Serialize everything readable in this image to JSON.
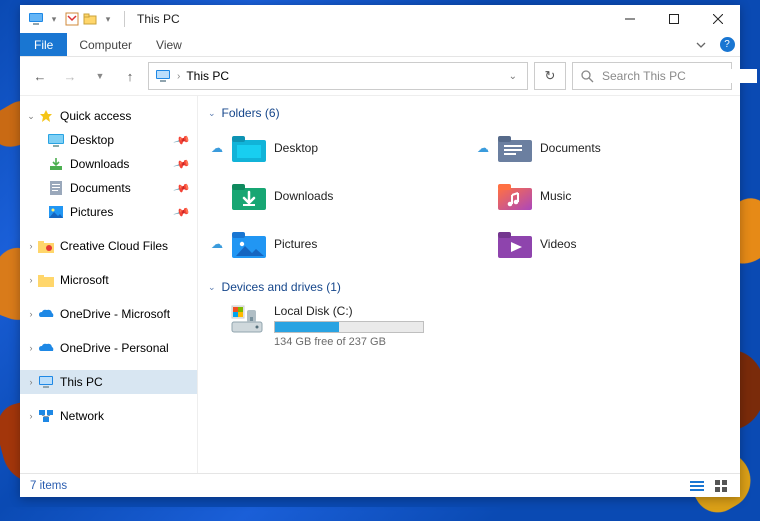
{
  "titlebar": {
    "title": "This PC"
  },
  "ribbon": {
    "file": "File",
    "tabs": [
      "Computer",
      "View"
    ]
  },
  "nav": {
    "breadcrumb_icon": "pc-icon",
    "breadcrumb": "This PC",
    "search_placeholder": "Search This PC"
  },
  "sidebar": {
    "quick_access": {
      "label": "Quick access",
      "items": [
        {
          "label": "Desktop",
          "icon": "desktop-blue",
          "pinned": true
        },
        {
          "label": "Downloads",
          "icon": "downloads",
          "pinned": true
        },
        {
          "label": "Documents",
          "icon": "documents",
          "pinned": true
        },
        {
          "label": "Pictures",
          "icon": "pictures",
          "pinned": true
        }
      ]
    },
    "roots": [
      {
        "label": "Creative Cloud Files",
        "icon": "cc-folder",
        "expandable": true
      },
      {
        "label": "Microsoft",
        "icon": "folder",
        "expandable": true
      },
      {
        "label": "OneDrive - Microsoft",
        "icon": "onedrive",
        "expandable": true
      },
      {
        "label": "OneDrive - Personal",
        "icon": "onedrive",
        "expandable": true
      },
      {
        "label": "This PC",
        "icon": "pc",
        "expandable": true,
        "selected": true
      },
      {
        "label": "Network",
        "icon": "network",
        "expandable": true
      }
    ]
  },
  "content": {
    "folders_header": "Folders (6)",
    "folders": [
      {
        "label": "Desktop",
        "icon": "desktop-folder",
        "sync": true
      },
      {
        "label": "Documents",
        "icon": "documents-folder",
        "sync": true
      },
      {
        "label": "Downloads",
        "icon": "downloads-folder",
        "sync": false
      },
      {
        "label": "Music",
        "icon": "music-folder",
        "sync": false
      },
      {
        "label": "Pictures",
        "icon": "pictures-folder",
        "sync": true
      },
      {
        "label": "Videos",
        "icon": "videos-folder",
        "sync": false
      }
    ],
    "drives_header": "Devices and drives (1)",
    "drives": [
      {
        "label": "Local Disk (C:)",
        "free_text": "134 GB free of 237 GB",
        "used_fraction": 0.435
      }
    ]
  },
  "statusbar": {
    "text": "7 items"
  },
  "colors": {
    "accent": "#1976d2",
    "link": "#15468b",
    "progress": "#29a3e2"
  }
}
